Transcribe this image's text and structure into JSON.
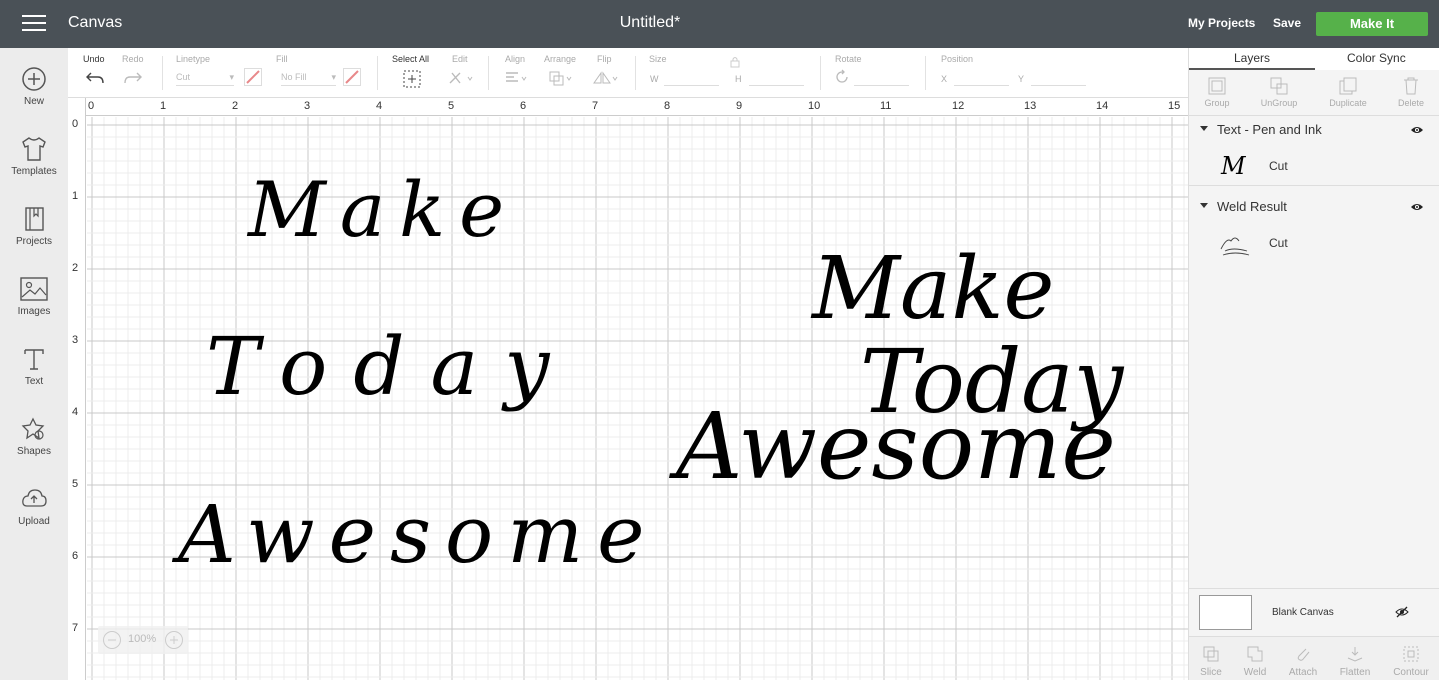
{
  "topbar": {
    "app_title": "Canvas",
    "doc_title": "Untitled*",
    "my_projects": "My Projects",
    "save": "Save",
    "make_it": "Make It",
    "accent": "#56b14a"
  },
  "sidebar": {
    "items": [
      {
        "label": "New",
        "icon": "plus-circle-icon"
      },
      {
        "label": "Templates",
        "icon": "tshirt-icon"
      },
      {
        "label": "Projects",
        "icon": "notebook-icon"
      },
      {
        "label": "Images",
        "icon": "image-icon"
      },
      {
        "label": "Text",
        "icon": "text-icon"
      },
      {
        "label": "Shapes",
        "icon": "shapes-icon"
      },
      {
        "label": "Upload",
        "icon": "upload-icon"
      }
    ]
  },
  "toolbar": {
    "undo": "Undo",
    "redo": "Redo",
    "linetype": "Linetype",
    "linetype_value": "Cut",
    "fill": "Fill",
    "fill_value": "No Fill",
    "select_all": "Select All",
    "edit": "Edit",
    "align": "Align",
    "arrange": "Arrange",
    "flip": "Flip",
    "size": "Size",
    "size_w": "W",
    "size_h": "H",
    "rotate": "Rotate",
    "position": "Position",
    "pos_x": "X",
    "pos_y": "Y"
  },
  "canvas": {
    "ruler_h": [
      "0",
      "1",
      "2",
      "3",
      "4",
      "5",
      "6",
      "7",
      "8",
      "9",
      "10",
      "11",
      "12",
      "13",
      "14",
      "15"
    ],
    "ruler_v": [
      "0",
      "1",
      "2",
      "3",
      "4",
      "5",
      "6",
      "7"
    ],
    "zoom": "100%",
    "text_left": [
      "Make",
      "Today",
      "Awesome"
    ],
    "text_right": [
      "Make",
      "Today",
      "Awesome"
    ]
  },
  "panel": {
    "tabs": [
      "Layers",
      "Color Sync"
    ],
    "tools": [
      "Group",
      "UnGroup",
      "Duplicate",
      "Delete"
    ],
    "groups": [
      {
        "name": "Text - Pen and Ink",
        "op": "Cut"
      },
      {
        "name": "Weld Result",
        "op": "Cut"
      }
    ],
    "blank_canvas": "Blank Canvas",
    "bottom_tools": [
      "Slice",
      "Weld",
      "Attach",
      "Flatten",
      "Contour"
    ]
  }
}
